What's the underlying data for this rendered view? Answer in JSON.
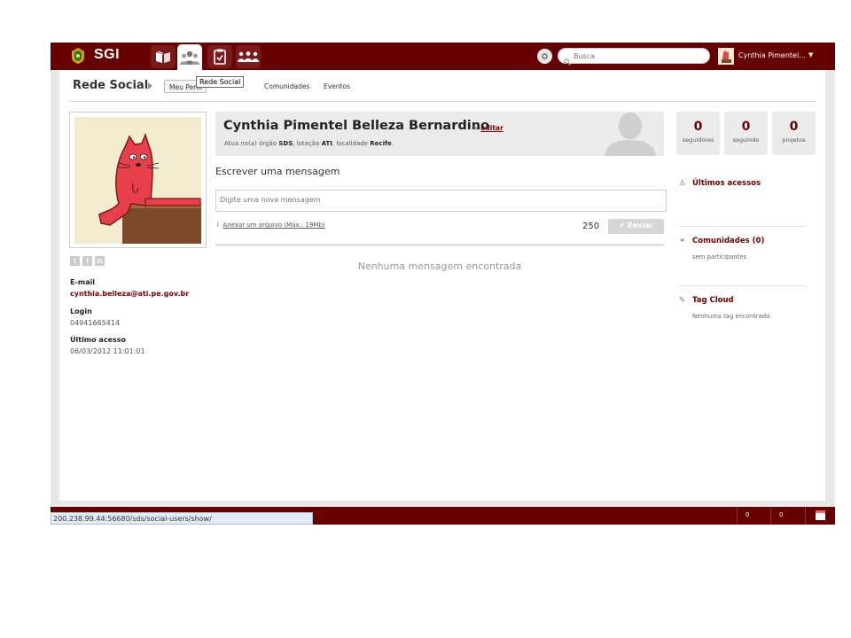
{
  "topbar": {
    "logo_text": "SGI",
    "apps": [
      {
        "name": "book-app-icon"
      },
      {
        "name": "social-network-app-icon",
        "active": true
      },
      {
        "name": "checklist-app-icon"
      },
      {
        "name": "community-app-icon"
      }
    ],
    "search_placeholder": "Busca",
    "user_name": "Cynthia Pimentel...",
    "caret": "▼"
  },
  "breadcrumb": {
    "title": "Rede Social",
    "tabs": [
      "Meu Perfil",
      "Comunidades",
      "Eventos"
    ],
    "tooltip": "Rede Social"
  },
  "profile": {
    "name": "Cynthia Pimentel Belleza Bernardino",
    "edit_label": "editar",
    "sub_prefix": "Atua no(a) órgão ",
    "org": "SDS",
    "sub_mid": ", lotação ",
    "unit": "ATI",
    "sub_mid2": ", localidade ",
    "locality": "Recife",
    "sub_end": "."
  },
  "sidebar_left": {
    "social": [
      "t",
      "f",
      "in"
    ],
    "email_label": "E-mail",
    "email": "cynthia.belleza@ati.pe.gov.br",
    "login_label": "Login",
    "login": "04941665414",
    "last_access_label": "Último acesso",
    "last_access": "06/03/2012 11:01:01"
  },
  "stats": [
    {
      "value": "0",
      "label": "seguidores"
    },
    {
      "value": "0",
      "label": "seguindo"
    },
    {
      "value": "0",
      "label": "projetos"
    }
  ],
  "composer": {
    "title": "Escrever uma mensagem",
    "placeholder": "Digite uma nova mensagem",
    "attach_label": "Anexar um arquivo (Máx.: 19Mb)",
    "char_count": "250",
    "send_label": "Enviar",
    "empty_feed": "Nenhuma mensagem encontrada"
  },
  "sidebar_right": {
    "last_access_title": "Últimos acessos",
    "communities_title": "Comunidades (0)",
    "communities_text": "sem participantes",
    "tagcloud_title": "Tag Cloud",
    "tagcloud_text": "Nenhuma tag encontrada"
  },
  "statusbar": {
    "url": "200.238.99.44:56680/sds/social-users/show/",
    "count1": "0",
    "count2": "0"
  },
  "colors": {
    "brand": "#660000",
    "accent_text": "#6b0000"
  }
}
